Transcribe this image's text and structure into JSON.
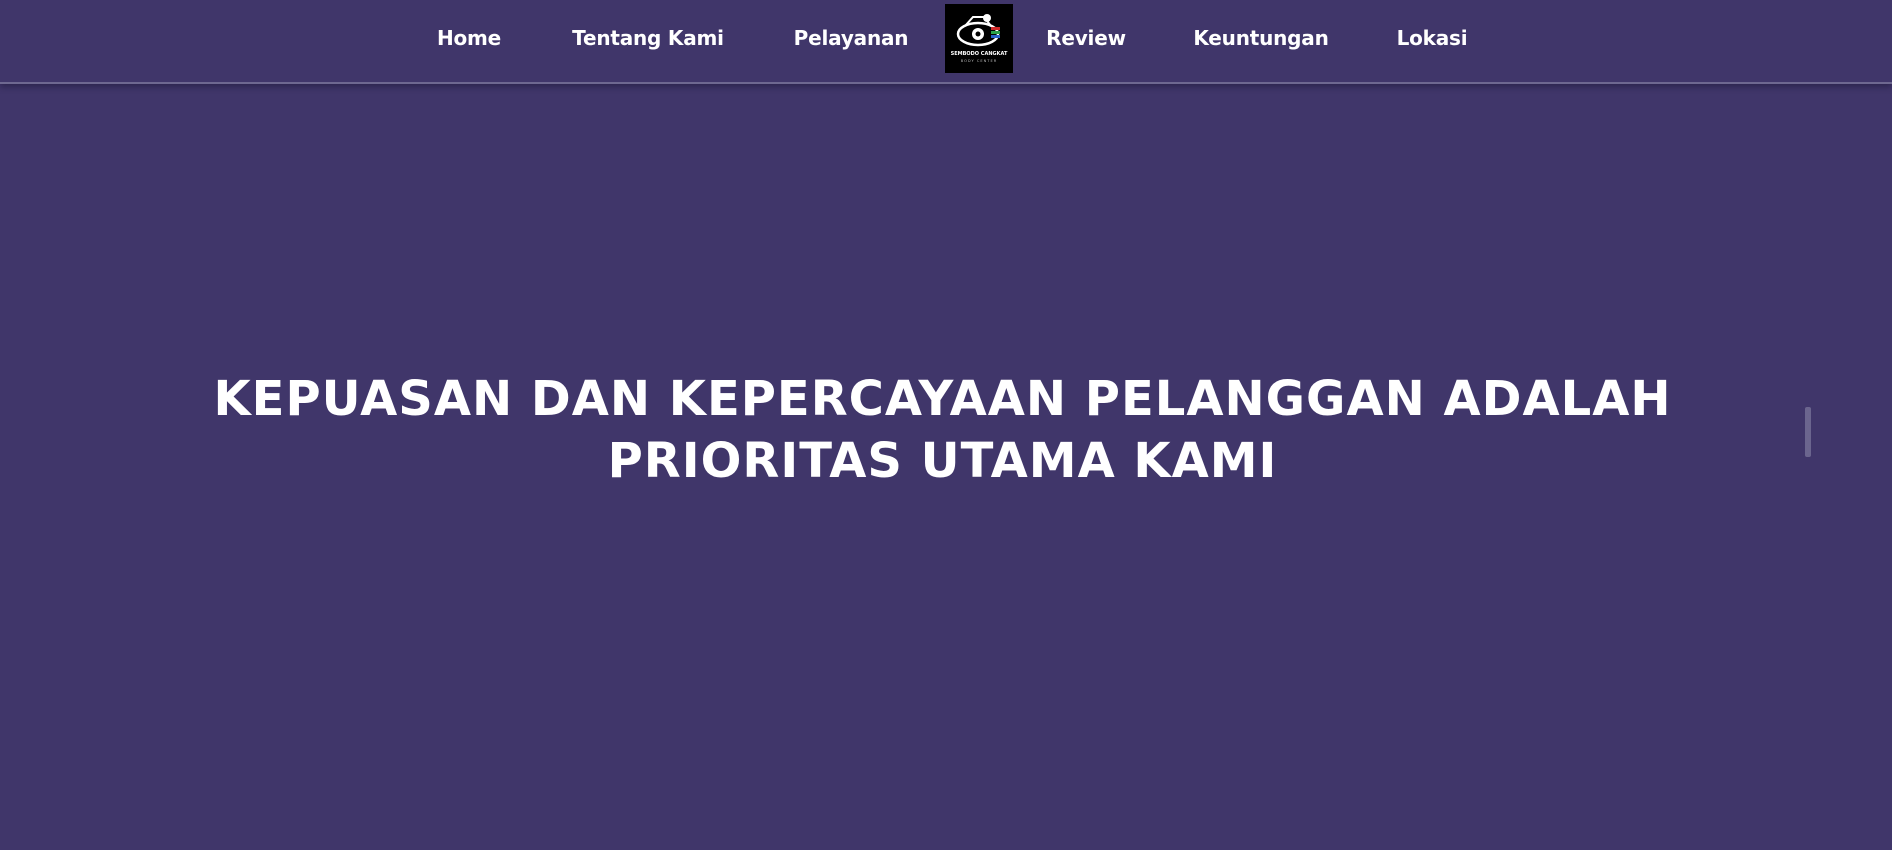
{
  "nav": {
    "items": [
      {
        "label": "Home"
      },
      {
        "label": "Tentang Kami"
      },
      {
        "label": "Pelayanan"
      },
      {
        "label": "Review"
      },
      {
        "label": "Keuntungan"
      },
      {
        "label": "Lokasi"
      }
    ],
    "logo": {
      "icon": "car-wheel-logo-icon",
      "text_line1": "SEMBODO CANGKAT",
      "text_line2": "BODY CENTER"
    }
  },
  "hero": {
    "title": "KEPUASAN DAN KEPERCAYAAN PELANGGAN ADALAH PRIORITAS UTAMA KAMI"
  },
  "colors": {
    "background": "#40366a",
    "nav_text": "#ffffff",
    "logo_bg": "#000000",
    "divider": "#6e6890"
  }
}
